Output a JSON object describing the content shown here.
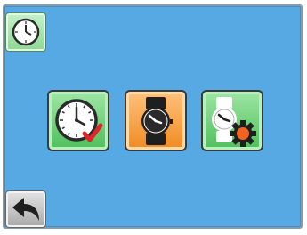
{
  "screen": {
    "background_color": "#56a9e3",
    "corner_icon": "clock-icon",
    "back_icon": "back-arrow-icon",
    "tiles": [
      {
        "icon": "clock-with-checkmark-icon",
        "color": "#4fbf5b"
      },
      {
        "icon": "wristwatch-icon",
        "color": "#f08a22"
      },
      {
        "icon": "watch-settings-icon",
        "color": "#4fbf5b"
      }
    ]
  }
}
